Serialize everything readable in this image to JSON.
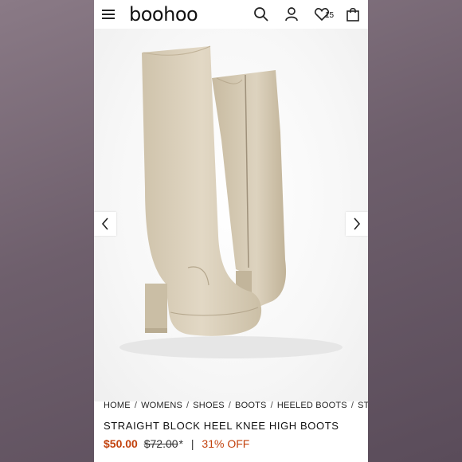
{
  "header": {
    "logo": "boohoo",
    "wishlist_count": "15",
    "icons": [
      "menu-icon",
      "search-icon",
      "account-icon",
      "heart-icon",
      "bag-icon"
    ]
  },
  "gallery": {
    "prev_icon": "chevron-left-icon",
    "next_icon": "chevron-right-icon"
  },
  "breadcrumb": {
    "items": [
      "HOME",
      "WOMENS",
      "SHOES",
      "BOOTS",
      "HEELED BOOTS",
      "STRAIGHT"
    ],
    "separator": "/"
  },
  "product": {
    "title": "STRAIGHT BLOCK HEEL KNEE HIGH BOOTS",
    "price": "$50.00",
    "original_price": "$72.00",
    "asterisk": "*",
    "divider": "|",
    "discount": "31% OFF"
  },
  "colors": {
    "accent": "#c2410c",
    "boot": "#ddd3bf"
  }
}
